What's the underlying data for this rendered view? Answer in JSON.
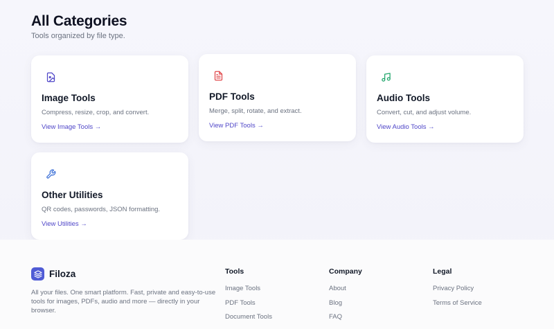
{
  "header": {
    "title": "All Categories",
    "subtitle": "Tools organized by file type."
  },
  "cards": [
    {
      "title": "Image Tools",
      "description": "Compress, resize, crop, and convert.",
      "link": "View Image Tools →",
      "icon": "image-icon",
      "icon_color": "#4f46c8"
    },
    {
      "title": "PDF Tools",
      "description": "Merge, split, rotate, and extract.",
      "link": "View PDF Tools →",
      "icon": "document-icon",
      "icon_color": "#e0484b"
    },
    {
      "title": "Audio Tools",
      "description": "Convert, cut, and adjust volume.",
      "link": "View Audio Tools →",
      "icon": "music-note-icon",
      "icon_color": "#1fa56a"
    },
    {
      "title": "Other Utilities",
      "description": "QR codes, passwords, JSON formatting.",
      "link": "View Utilities →",
      "icon": "wrench-icon",
      "icon_color": "#3b6fd6"
    }
  ],
  "footer": {
    "brand": {
      "name": "Filoza",
      "description": "All your files. One smart platform. Fast, private and easy-to-use tools for images, PDFs, audio and more — directly in your browser.",
      "logo_color": "#4f5bd5"
    },
    "columns": [
      {
        "heading": "Tools",
        "links": [
          "Image Tools",
          "PDF Tools",
          "Document Tools"
        ]
      },
      {
        "heading": "Company",
        "links": [
          "About",
          "Blog",
          "FAQ"
        ]
      },
      {
        "heading": "Legal",
        "links": [
          "Privacy Policy",
          "Terms of Service"
        ]
      }
    ]
  },
  "colors": {
    "accent": "#4f46c8",
    "muted_text": "#6b7280"
  }
}
